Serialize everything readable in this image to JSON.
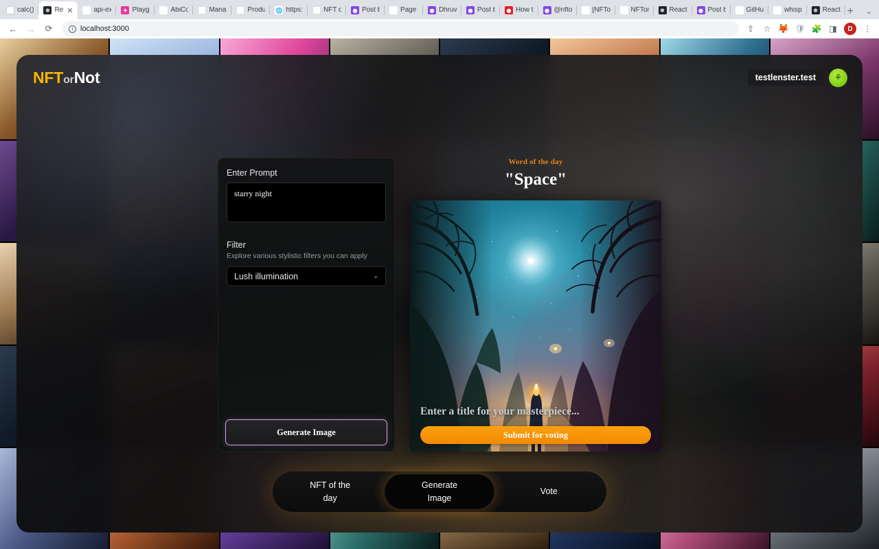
{
  "browser": {
    "tabs": [
      {
        "title": "calc()",
        "favicon": "calculator-icon",
        "fav_class": "fav-calc",
        "glyph": "▦",
        "active": false
      },
      {
        "title": "Re",
        "favicon": "react-icon",
        "fav_class": "fav-react",
        "glyph": "⚛",
        "active": true
      },
      {
        "title": "api-ex",
        "favicon": "github-icon",
        "fav_class": "fav-github",
        "glyph": "⬤",
        "active": false
      },
      {
        "title": "Playgr",
        "favicon": "playground-icon",
        "fav_class": "fav-pink",
        "glyph": "✦",
        "active": false
      },
      {
        "title": "AbiCo",
        "favicon": "abi-icon",
        "fav_class": "fav-globe",
        "glyph": "◯",
        "active": false
      },
      {
        "title": "Manag",
        "favicon": "manage-icon",
        "fav_class": "fav-lpurple",
        "glyph": "◉",
        "active": false
      },
      {
        "title": "Produ",
        "favicon": "product-icon",
        "fav_class": "fav-lpurple",
        "glyph": "◉",
        "active": false
      },
      {
        "title": "https:",
        "favicon": "globe-icon",
        "fav_class": "fav-globe",
        "glyph": "🌐",
        "active": false
      },
      {
        "title": "NFT o",
        "favicon": "github-icon",
        "fav_class": "fav-gray",
        "glyph": "◯",
        "active": false
      },
      {
        "title": "Post b",
        "favicon": "lens-icon",
        "fav_class": "fav-purple",
        "glyph": "◉",
        "active": false
      },
      {
        "title": "Page r",
        "favicon": "github-icon",
        "fav_class": "fav-github",
        "glyph": "◉",
        "active": false
      },
      {
        "title": "Dhruv",
        "favicon": "lens-icon",
        "fav_class": "fav-purple",
        "glyph": "◉",
        "active": false
      },
      {
        "title": "Post b",
        "favicon": "lens-icon",
        "fav_class": "fav-purple",
        "glyph": "◉",
        "active": false
      },
      {
        "title": "How t",
        "favicon": "red-icon",
        "fav_class": "fav-red",
        "glyph": "◉",
        "active": false
      },
      {
        "title": "@nfto",
        "favicon": "lens-icon",
        "fav_class": "fav-purple",
        "glyph": "◉",
        "active": false
      },
      {
        "title": "[NFTo",
        "favicon": "gmail-icon",
        "fav_class": "fav-gmail",
        "glyph": "M",
        "active": false
      },
      {
        "title": "NFTor",
        "favicon": "github-icon",
        "fav_class": "fav-github",
        "glyph": "◉",
        "active": false
      },
      {
        "title": "React",
        "favicon": "react-icon",
        "fav_class": "fav-react",
        "glyph": "⚛",
        "active": false
      },
      {
        "title": "Post b",
        "favicon": "lens-icon",
        "fav_class": "fav-purple",
        "glyph": "◉",
        "active": false
      },
      {
        "title": "GitHu",
        "favicon": "github-icon",
        "fav_class": "fav-github",
        "glyph": "◉",
        "active": false
      },
      {
        "title": "whisp",
        "favicon": "github-icon",
        "fav_class": "fav-github",
        "glyph": "◉",
        "active": false
      },
      {
        "title": "React",
        "favicon": "react-icon",
        "fav_class": "fav-react",
        "glyph": "⚛",
        "active": false
      }
    ],
    "new_tab_label": "+",
    "tab_search_label": "⌄",
    "close_label": "✕",
    "nav": {
      "back": "←",
      "forward": "→",
      "reload": "⟳"
    },
    "omnibox": {
      "value": "localhost:3000",
      "info_glyph": "i"
    },
    "toolbar_icons": [
      {
        "name": "share-icon",
        "glyph": "⇪"
      },
      {
        "name": "bookmark-star-icon",
        "glyph": "☆"
      },
      {
        "name": "metamask-fox-icon",
        "glyph": "🦊"
      },
      {
        "name": "shield-extension-icon",
        "glyph": "🛡"
      },
      {
        "name": "extensions-puzzle-icon",
        "glyph": "🧩"
      },
      {
        "name": "side-panel-icon",
        "glyph": "◨"
      },
      {
        "name": "profile-avatar-icon",
        "glyph": "D"
      },
      {
        "name": "chrome-menu-icon",
        "glyph": "⋮"
      }
    ]
  },
  "app": {
    "logo": {
      "nft": "NFT",
      "or": "or",
      "not": "Not"
    },
    "profile": {
      "handle": "testlenster.test",
      "avatar_glyph": "⚘"
    },
    "form": {
      "prompt_label": "Enter Prompt",
      "prompt_value": "starry night",
      "filter_label": "Filter",
      "filter_desc": "Explore various stylistic filters you can apply",
      "filter_selected": "Lush illumination",
      "filter_chevron": "⌄",
      "generate_label": "Generate Image"
    },
    "showcase": {
      "wotd_label": "Word of the day",
      "wotd_word": "\"Space\"",
      "title_placeholder": "Enter a title for your masterpiece...",
      "submit_label": "Submit for voting",
      "artwork_alt": "starry-night-forest-path"
    },
    "bottom_nav": {
      "items": [
        {
          "line1": "NFT of the",
          "line2": "day",
          "active": false,
          "key": "nft-of-the-day"
        },
        {
          "line1": "Generate",
          "line2": "Image",
          "active": true,
          "key": "generate-image"
        },
        {
          "line1": "Vote",
          "line2": "",
          "active": false,
          "key": "vote"
        }
      ]
    },
    "colors": {
      "accent_gold": "#f7b500",
      "accent_orange": "#f38b05",
      "wotd_orange": "#e8831a",
      "generate_border": "#d9a6e8",
      "avatar_green": "#7ccc19"
    }
  }
}
